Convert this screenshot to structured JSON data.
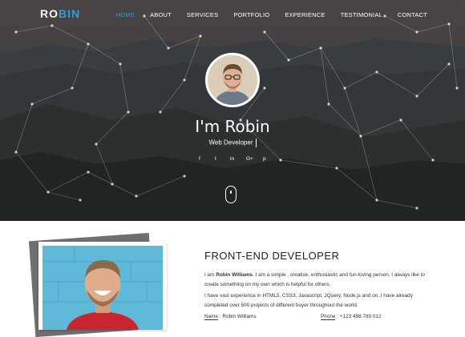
{
  "nav": {
    "logo_a": "RO",
    "logo_b": "BIN",
    "items": [
      "HOME",
      "ABOUT",
      "SERVICES",
      "PORTFOLIO",
      "EXPERIENCE",
      "TESTIMONIAL",
      "CONTACT"
    ],
    "active_index": 0
  },
  "hero": {
    "name": "I'm Robin",
    "role": "Web Developer",
    "social_icons": [
      "facebook-icon",
      "twitter-icon",
      "linkedin-icon",
      "google-plus-icon",
      "pinterest-icon"
    ],
    "social_glyphs": [
      "f",
      "t",
      "in",
      "G+",
      "p"
    ]
  },
  "about": {
    "title": "FRONT-END DEVELOPER",
    "p1_prefix": "I am ",
    "p1_name": "Robin Williams",
    "p1_rest": ". I am a simple , creative, enthusiastic and fun-loving person. I always like to create something on my own which is helpful for others.",
    "p2": "I have vast experience in HTML5, CSS3, Javascript, JQuery, Node.js and on. I have already completed over 500 projects of different buyer throughout the world.",
    "name_label": "Name",
    "name_value": ": Robin Williams",
    "phone_label": "Phone",
    "phone_value": ": +123 456 789 012"
  },
  "colors": {
    "accent": "#2e9fd8",
    "hero_bg": "#3a3a3c"
  }
}
